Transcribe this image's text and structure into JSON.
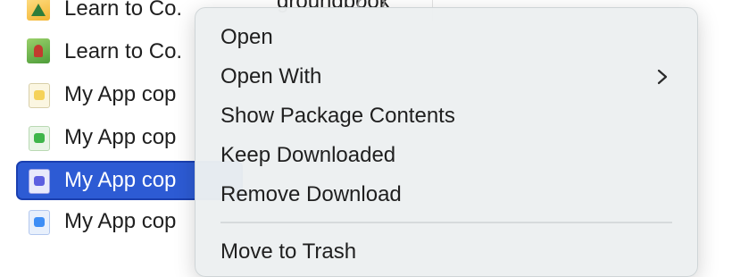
{
  "file_list": {
    "partial_top": {
      "label": "Learn to Co.",
      "overlap_text": "groundbook"
    },
    "rows": [
      {
        "label": "Learn to Co.",
        "icon": "playground-book-icon"
      },
      {
        "label": "My App cop",
        "icon": "swift-playground-app-icon"
      },
      {
        "label": "My App cop",
        "icon": "swift-playground-app-icon"
      },
      {
        "label": "My App cop",
        "icon": "swift-playground-app-icon"
      },
      {
        "label": "My App cop",
        "icon": "swift-playground-app-icon"
      }
    ],
    "selected_color": "#2d5bd4"
  },
  "context_menu": {
    "items": [
      {
        "label": "Open"
      },
      {
        "label": "Open With",
        "has_submenu": true
      },
      {
        "label": "Show Package Contents"
      },
      {
        "label": "Keep Downloaded"
      },
      {
        "label": "Remove Download"
      }
    ],
    "partial_item": "Move to Trash"
  }
}
